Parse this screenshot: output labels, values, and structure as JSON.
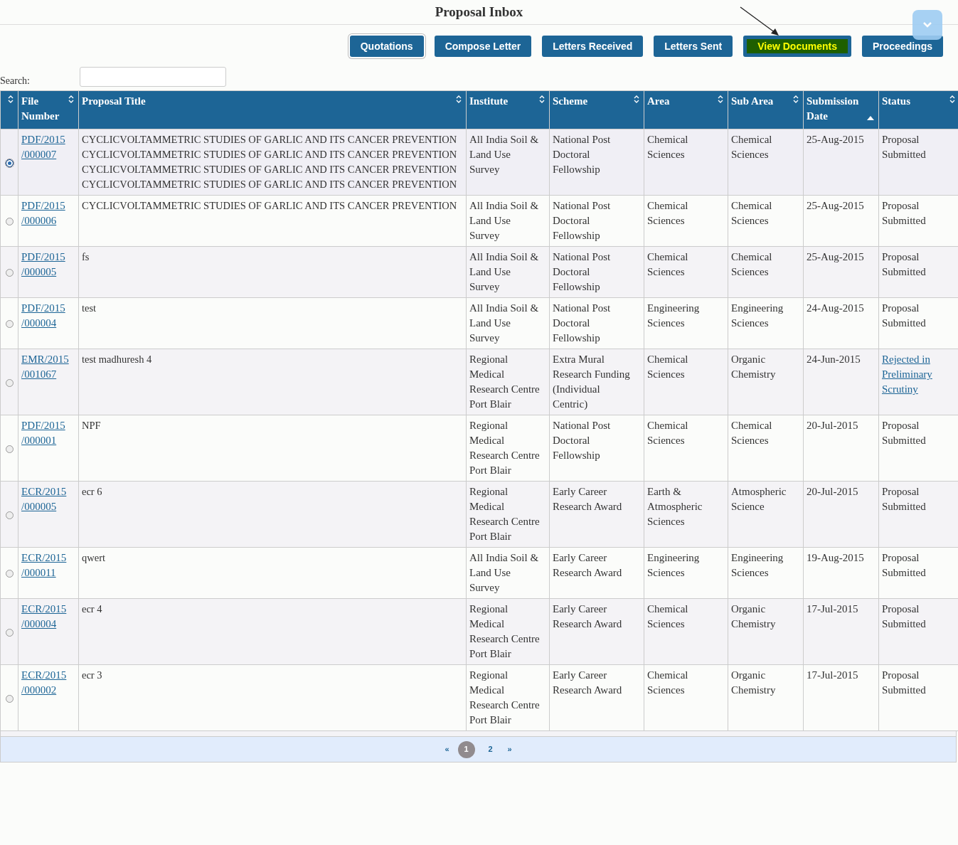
{
  "title": "Proposal Inbox",
  "buttons": [
    {
      "label": "Quotations",
      "selected": true,
      "highlighted": false
    },
    {
      "label": "Compose Letter",
      "selected": false,
      "highlighted": false
    },
    {
      "label": "Letters Received",
      "selected": false,
      "highlighted": false
    },
    {
      "label": "Letters Sent",
      "selected": false,
      "highlighted": false
    },
    {
      "label": "View Documents",
      "selected": false,
      "highlighted": true
    },
    {
      "label": "Proceedings",
      "selected": false,
      "highlighted": false
    }
  ],
  "search": {
    "label": "Search:"
  },
  "table": {
    "columns": [
      {
        "sorted": false
      },
      {
        "label": "File Number",
        "sorted": false
      },
      {
        "label": "Proposal Title",
        "sorted": false
      },
      {
        "label": "Institute",
        "sorted": false
      },
      {
        "label": "Scheme",
        "sorted": false
      },
      {
        "label": "Area",
        "sorted": false
      },
      {
        "label": "Sub Area",
        "sorted": false
      },
      {
        "label": "Submission Date",
        "sorted": true
      },
      {
        "label": "Status",
        "sorted": false
      }
    ],
    "rows": [
      {
        "selected": true,
        "file": "PDF/2015 /000007",
        "title": "CYCLICVOLTAMMETRIC STUDIES OF GARLIC AND ITS CANCER PREVENTION CYCLICVOLTAMMETRIC STUDIES OF GARLIC AND ITS CANCER PREVENTION CYCLICVOLTAMMETRIC STUDIES OF GARLIC AND ITS CANCER PREVENTION CYCLICVOLTAMMETRIC STUDIES OF GARLIC AND ITS CANCER PREVENTION",
        "institute": "All India Soil & Land Use Survey",
        "scheme": "National Post Doctoral Fellowship",
        "area": "Chemical Sciences",
        "sub_area": "Chemical Sciences",
        "date": "25-Aug-2015",
        "status": {
          "kind": "text",
          "text": "Proposal Submitted"
        }
      },
      {
        "selected": false,
        "file": "PDF/2015 /000006",
        "title": "CYCLICVOLTAMMETRIC STUDIES OF GARLIC AND ITS CANCER PREVENTION",
        "institute": "All India Soil & Land Use Survey",
        "scheme": "National Post Doctoral Fellowship",
        "area": "Chemical Sciences",
        "sub_area": "Chemical Sciences",
        "date": "25-Aug-2015",
        "status": {
          "kind": "text",
          "text": "Proposal Submitted"
        }
      },
      {
        "selected": false,
        "file": "PDF/2015 /000005",
        "title": "fs",
        "institute": "All India Soil & Land Use Survey",
        "scheme": "National Post Doctoral Fellowship",
        "area": "Chemical Sciences",
        "sub_area": "Chemical Sciences",
        "date": "25-Aug-2015",
        "status": {
          "kind": "text",
          "text": "Proposal Submitted"
        }
      },
      {
        "selected": false,
        "file": "PDF/2015 /000004",
        "title": "test",
        "institute": "All India Soil & Land Use Survey",
        "scheme": "National Post Doctoral Fellowship",
        "area": "Engineering Sciences",
        "sub_area": "Engineering Sciences",
        "date": "24-Aug-2015",
        "status": {
          "kind": "text",
          "text": "Proposal Submitted"
        }
      },
      {
        "selected": false,
        "file": "EMR/2015 /001067",
        "title": "test madhuresh 4",
        "institute": "Regional Medical Research Centre Port Blair",
        "scheme": "Extra Mural Research Funding (Individual Centric)",
        "area": "Chemical Sciences",
        "sub_area": "Organic Chemistry",
        "date": "24-Jun-2015",
        "status": {
          "kind": "link",
          "text": "Rejected in Preliminary Scrutiny"
        }
      },
      {
        "selected": false,
        "file": "PDF/2015 /000001",
        "title": "NPF",
        "institute": "Regional Medical Research Centre Port Blair",
        "scheme": "National Post Doctoral Fellowship",
        "area": "Chemical Sciences",
        "sub_area": "Chemical Sciences",
        "date": "20-Jul-2015",
        "status": {
          "kind": "text",
          "text": "Proposal Submitted"
        }
      },
      {
        "selected": false,
        "file": "ECR/2015 /000005",
        "title": "ecr 6",
        "institute": "Regional Medical Research Centre Port Blair",
        "scheme": "Early Career Research Award",
        "area": "Earth & Atmospheric Sciences",
        "sub_area": "Atmospheric Science",
        "date": "20-Jul-2015",
        "status": {
          "kind": "text",
          "text": "Proposal Submitted"
        }
      },
      {
        "selected": false,
        "file": "ECR/2015 /000011",
        "title": "qwert",
        "institute": "All India Soil & Land Use Survey",
        "scheme": "Early Career Research Award",
        "area": "Engineering Sciences",
        "sub_area": "Engineering Sciences",
        "date": "19-Aug-2015",
        "status": {
          "kind": "text",
          "text": "Proposal Submitted"
        }
      },
      {
        "selected": false,
        "file": "ECR/2015 /000004",
        "title": "ecr 4",
        "institute": "Regional Medical Research Centre Port Blair",
        "scheme": "Early Career Research Award",
        "area": "Chemical Sciences",
        "sub_area": "Organic Chemistry",
        "date": "17-Jul-2015",
        "status": {
          "kind": "text",
          "text": "Proposal Submitted"
        }
      },
      {
        "selected": false,
        "file": "ECR/2015 /000002",
        "title": "ecr 3",
        "institute": "Regional Medical Research Centre Port Blair",
        "scheme": "Early Career Research Award",
        "area": "Chemical Sciences",
        "sub_area": "Organic Chemistry",
        "date": "17-Jul-2015",
        "status": {
          "kind": "text",
          "text": "Proposal Submitted"
        }
      }
    ]
  },
  "pagination": {
    "prev": "«",
    "next": "»",
    "pages": [
      {
        "label": "1",
        "selected": true
      },
      {
        "label": "2",
        "selected": false
      }
    ]
  }
}
